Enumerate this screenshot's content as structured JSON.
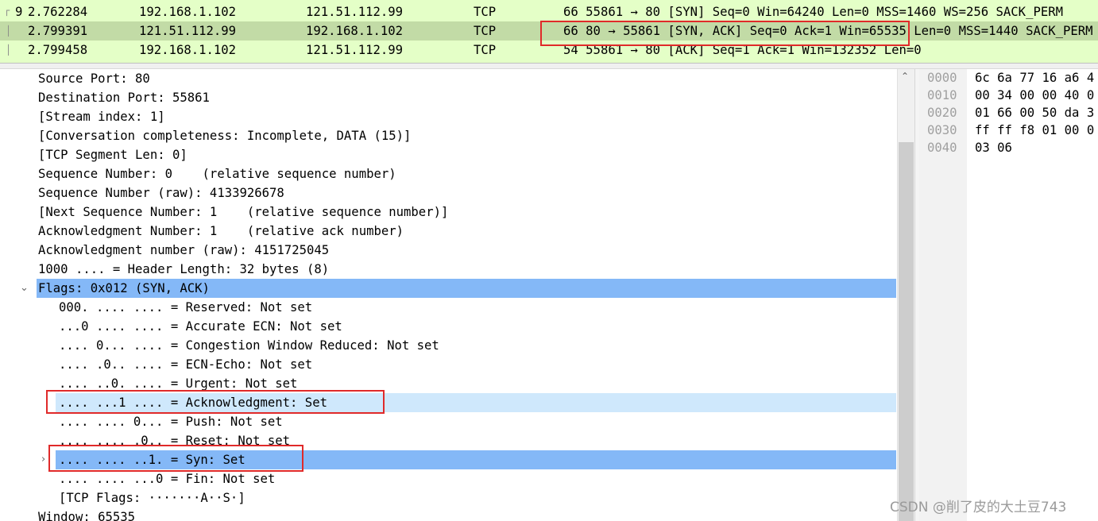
{
  "packet_list": [
    {
      "no": "9",
      "time": "2.762284",
      "source": "192.168.1.102",
      "destination": "121.51.112.99",
      "protocol": "TCP",
      "info": "66 55861 → 80 [SYN] Seq=0 Win=64240 Len=0 MSS=1460 WS=256 SACK_PERM"
    },
    {
      "no": "",
      "time": "2.799391",
      "source": "121.51.112.99",
      "destination": "192.168.1.102",
      "protocol": "TCP",
      "info": "66 80 → 55861 [SYN, ACK] Seq=0 Ack=1 Win=65535 Len=0 MSS=1440 SACK_PERM"
    },
    {
      "no": "",
      "time": "2.799458",
      "source": "192.168.1.102",
      "destination": "121.51.112.99",
      "protocol": "TCP",
      "info": "54 55861 → 80 [ACK] Seq=1 Ack=1 Win=132352 Len=0"
    }
  ],
  "detail": {
    "lines": [
      "Source Port: 80",
      "Destination Port: 55861",
      "[Stream index: 1]",
      "[Conversation completeness: Incomplete, DATA (15)]",
      "[TCP Segment Len: 0]",
      "Sequence Number: 0    (relative sequence number)",
      "Sequence Number (raw): 4133926678",
      "[Next Sequence Number: 1    (relative sequence number)]",
      "Acknowledgment Number: 1    (relative ack number)",
      "Acknowledgment number (raw): 4151725045",
      "1000 .... = Header Length: 32 bytes (8)"
    ],
    "flags_header": "Flags: 0x012 (SYN, ACK)",
    "flag_lines": [
      "000. .... .... = Reserved: Not set",
      "...0 .... .... = Accurate ECN: Not set",
      ".... 0... .... = Congestion Window Reduced: Not set",
      ".... .0.. .... = ECN-Echo: Not set",
      ".... ..0. .... = Urgent: Not set",
      ".... ...1 .... = Acknowledgment: Set",
      ".... .... 0... = Push: Not set",
      ".... .... .0.. = Reset: Not set",
      ".... .... ..1. = Syn: Set",
      ".... .... ...0 = Fin: Not set",
      "[TCP Flags: ·······A··S·]"
    ],
    "window_line": "Window: 65535"
  },
  "hex": {
    "offsets": [
      "0000",
      "0010",
      "0020",
      "0030",
      "0040"
    ],
    "bytes": [
      "6c 6a 77 16 a6 4",
      "00 34 00 00 40 0",
      "01 66 00 50 da 3",
      "ff ff f8 01 00 0",
      "03 06"
    ]
  },
  "watermark": "CSDN @削了皮的大土豆743",
  "colors": {
    "packet_bg": "#e4ffc7",
    "packet_selected": "#c2dba6",
    "detail_selected": "#84b8f7",
    "detail_related": "#cfe8fc",
    "annotation_red": "#e02a2a"
  }
}
